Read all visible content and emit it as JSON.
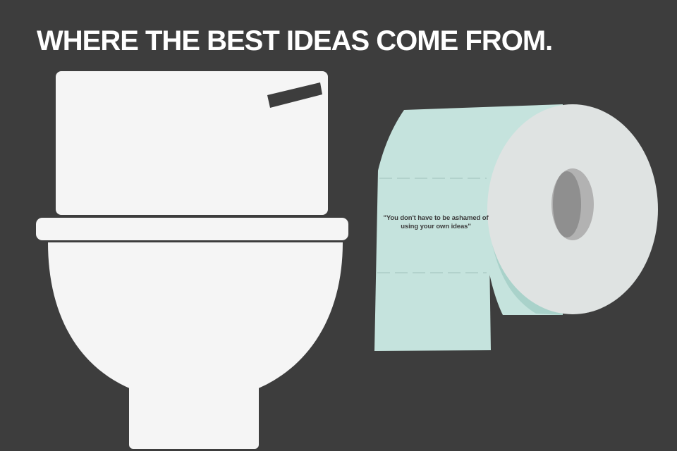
{
  "headline": "WHERE THE BEST IDEAS COME FROM.",
  "paper_quote": "\"You don't have to be ashamed of using your own ideas\"",
  "colors": {
    "background": "#3d3d3d",
    "toilet": "#f5f5f5",
    "flush_handle": "#3d3d3d",
    "paper_sheet": "#c5e3dd",
    "paper_roll_side": "#dfe3e2",
    "paper_core": "#8f8f8f"
  },
  "icons": [
    "toilet-icon",
    "toilet-paper-roll-icon"
  ]
}
